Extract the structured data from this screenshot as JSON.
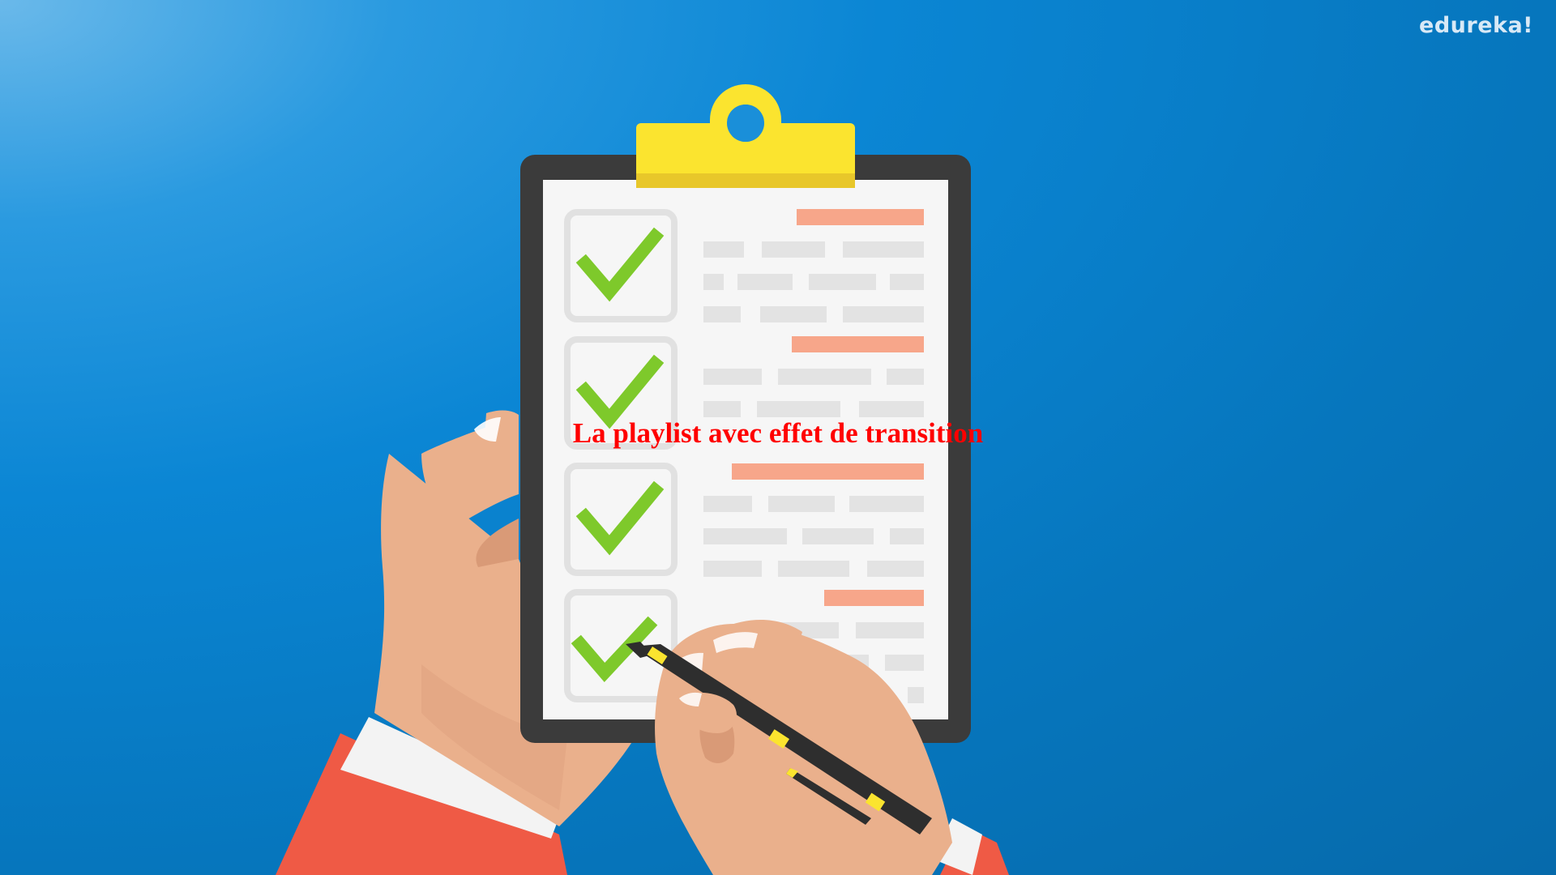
{
  "brand": {
    "logo_text": "edureka!"
  },
  "video": {
    "caption": "La playlist avec effet de transition"
  },
  "illustration": {
    "items": [
      {
        "checked": true
      },
      {
        "checked": true
      },
      {
        "checked": true
      },
      {
        "checked": true
      }
    ]
  },
  "colors": {
    "background": "#0b86d4",
    "clipboard_frame": "#3b3b3b",
    "clip": "#fbe42f",
    "checkmark": "#7ec92b",
    "heading_bar": "#f7a68a",
    "text_bar": "#e3e3e3",
    "skin": "#eab08c",
    "sleeve": "#ef5a45",
    "caption": "#ff0000"
  }
}
